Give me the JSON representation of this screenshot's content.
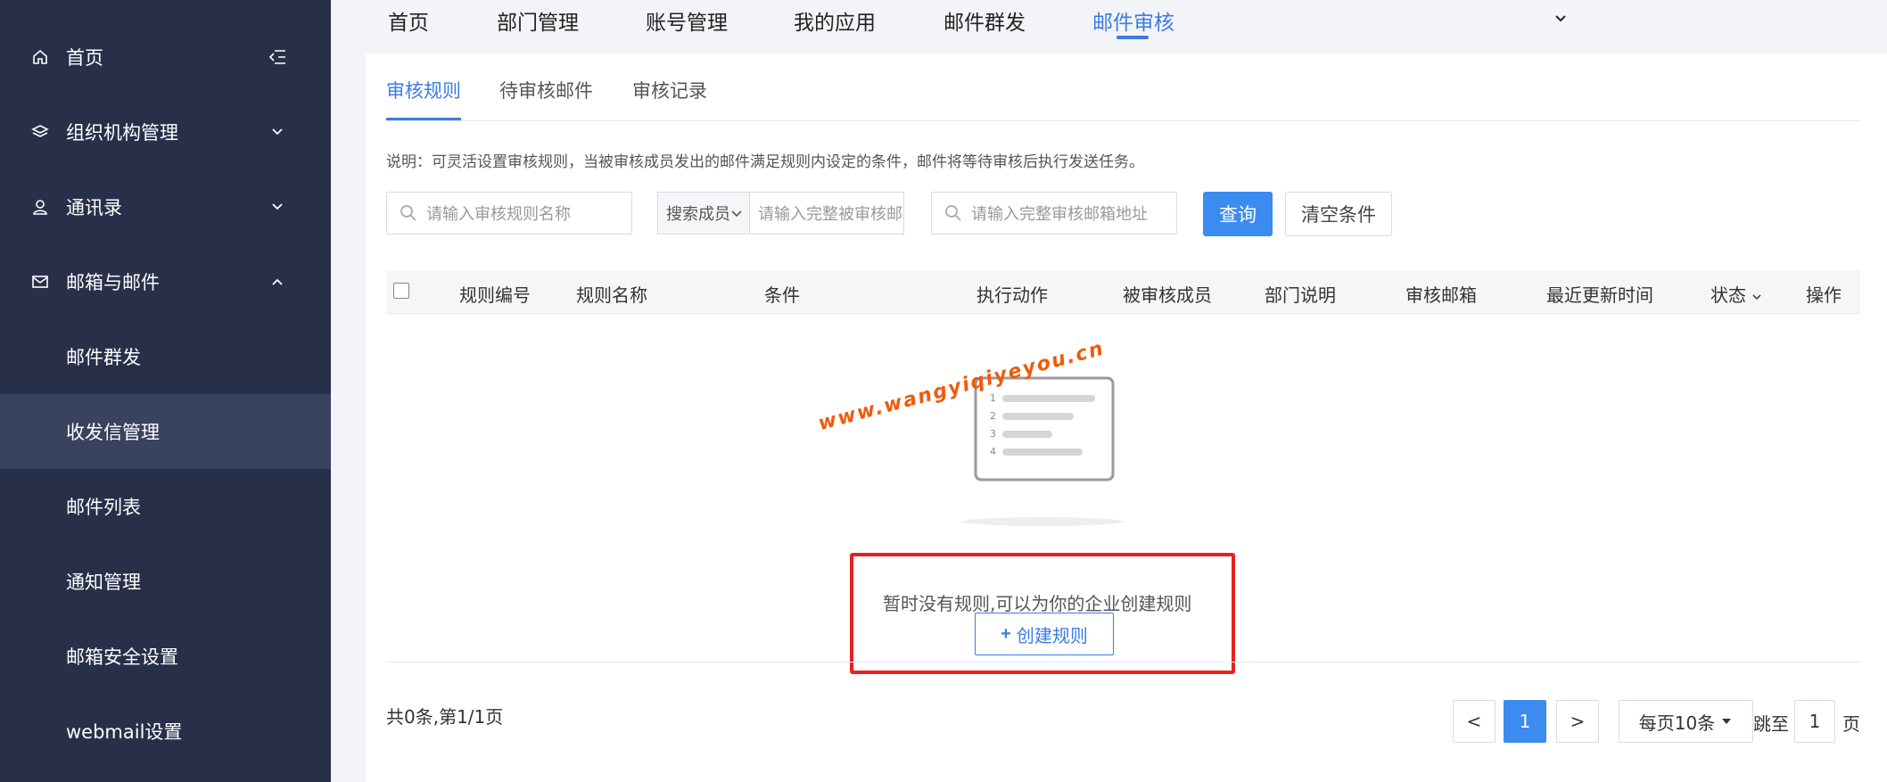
{
  "sidebar": {
    "items": [
      {
        "label": "首页"
      },
      {
        "label": "组织机构管理"
      },
      {
        "label": "通讯录"
      },
      {
        "label": "邮箱与邮件"
      },
      {
        "label": "邮件群发"
      },
      {
        "label": "收发信管理"
      },
      {
        "label": "邮件列表"
      },
      {
        "label": "通知管理"
      },
      {
        "label": "邮箱安全设置"
      },
      {
        "label": "webmail设置"
      }
    ]
  },
  "topnav": {
    "tabs": [
      {
        "label": "首页"
      },
      {
        "label": "部门管理"
      },
      {
        "label": "账号管理"
      },
      {
        "label": "我的应用"
      },
      {
        "label": "邮件群发"
      },
      {
        "label": "邮件审核"
      }
    ]
  },
  "subtabs": [
    {
      "label": "审核规则"
    },
    {
      "label": "待审核邮件"
    },
    {
      "label": "审核记录"
    }
  ],
  "description": "说明：可灵活设置审核规则，当被审核成员发出的邮件满足规则内设定的条件，邮件将等待审核后执行发送任务。",
  "filters": {
    "rule_name_placeholder": "请输入审核规则名称",
    "member_select": "搜索成员",
    "member_placeholder": "请输入完整被审核邮",
    "audit_mailbox_placeholder": "请输入完整审核邮箱地址",
    "query_label": "查询",
    "clear_label": "清空条件"
  },
  "table": {
    "headers": [
      "规则编号",
      "规则名称",
      "条件",
      "执行动作",
      "被审核成员",
      "部门说明",
      "审核邮箱",
      "最近更新时间",
      "状态",
      "操作"
    ]
  },
  "empty": {
    "illustration_lines": [
      "1",
      "2",
      "3",
      "4"
    ],
    "watermark": "www.wangyiqiyeyou.cn",
    "message": "暂时没有规则,可以为你的企业创建规则",
    "create_label": "创建规则",
    "create_plus": "+"
  },
  "pagination": {
    "total": "共0条,第1/1页",
    "prev": "<",
    "current": "1",
    "next": ">",
    "page_size": "每页10条",
    "jump_label": "跳至",
    "jump_value": "1",
    "page_suffix": "页"
  },
  "colors": {
    "sidebar_bg": "#283049",
    "accent": "#3b7be8",
    "primary_button": "#3b8bf0",
    "highlight_box": "#e8201e",
    "watermark": "#f15a0a"
  }
}
